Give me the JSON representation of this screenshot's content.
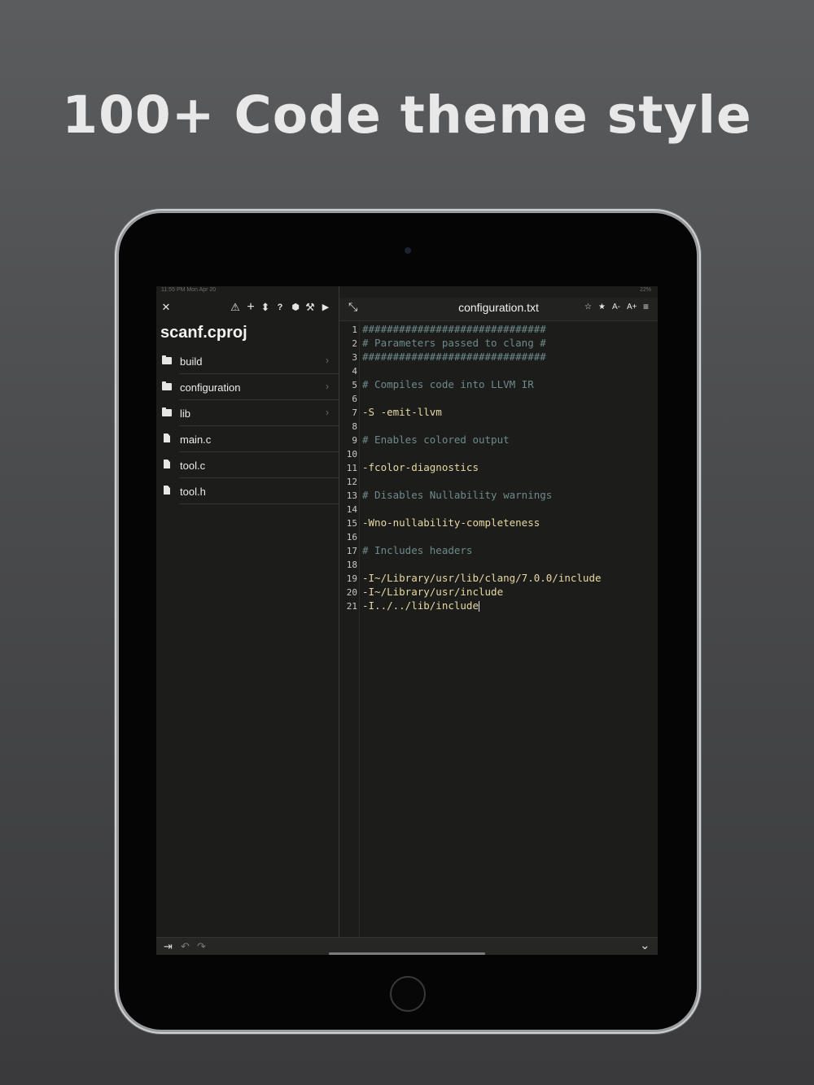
{
  "headline": "100+ Code theme style",
  "status": {
    "time": "11:55 PM  Mon Apr 20",
    "battery": "22%"
  },
  "sidebar": {
    "project": "scanf.cproj",
    "items": [
      {
        "name": "build",
        "type": "folder"
      },
      {
        "name": "configuration",
        "type": "folder"
      },
      {
        "name": "lib",
        "type": "folder"
      },
      {
        "name": "main.c",
        "type": "file"
      },
      {
        "name": "tool.c",
        "type": "file"
      },
      {
        "name": "tool.h",
        "type": "file"
      }
    ],
    "toolbar": {
      "close": "✕",
      "warning": "⚠",
      "add": "+",
      "sort": "⬍",
      "help": "?",
      "package": "⬢",
      "build": "⚒",
      "run": "▶"
    }
  },
  "editor": {
    "filename": "configuration.txt",
    "icons": {
      "expand": "⤡",
      "star_outline": "☆",
      "star": "★",
      "font_down": "A-",
      "font_up": "A+",
      "menu": "≡"
    },
    "lines": [
      {
        "n": "1",
        "text": "##############################",
        "kind": "comment"
      },
      {
        "n": "2",
        "text": "# Parameters passed to clang #",
        "kind": "comment"
      },
      {
        "n": "3",
        "text": "##############################",
        "kind": "comment"
      },
      {
        "n": "4",
        "text": "",
        "kind": "text"
      },
      {
        "n": "5",
        "text": "# Compiles code into LLVM IR",
        "kind": "comment"
      },
      {
        "n": "6",
        "text": "",
        "kind": "text"
      },
      {
        "n": "7",
        "text": "-S -emit-llvm",
        "kind": "text"
      },
      {
        "n": "8",
        "text": "",
        "kind": "text"
      },
      {
        "n": "9",
        "text": "# Enables colored output",
        "kind": "comment"
      },
      {
        "n": "10",
        "text": "",
        "kind": "text"
      },
      {
        "n": "11",
        "text": "-fcolor-diagnostics",
        "kind": "text"
      },
      {
        "n": "12",
        "text": "",
        "kind": "text"
      },
      {
        "n": "13",
        "text": "# Disables Nullability warnings",
        "kind": "comment"
      },
      {
        "n": "14",
        "text": "",
        "kind": "text"
      },
      {
        "n": "15",
        "text": "-Wno-nullability-completeness",
        "kind": "text"
      },
      {
        "n": "16",
        "text": "",
        "kind": "text"
      },
      {
        "n": "17",
        "text": "# Includes headers",
        "kind": "comment"
      },
      {
        "n": "18",
        "text": "",
        "kind": "text"
      },
      {
        "n": "19",
        "text": "-I~/Library/usr/lib/clang/7.0.0/include",
        "kind": "text"
      },
      {
        "n": "20",
        "text": "-I~/Library/usr/include",
        "kind": "text"
      },
      {
        "n": "21",
        "text": "-I../../lib/include",
        "kind": "text"
      }
    ]
  },
  "bottom": {
    "tab": "⇥",
    "undo": "↶",
    "redo": "↷",
    "collapse": "⌄"
  }
}
